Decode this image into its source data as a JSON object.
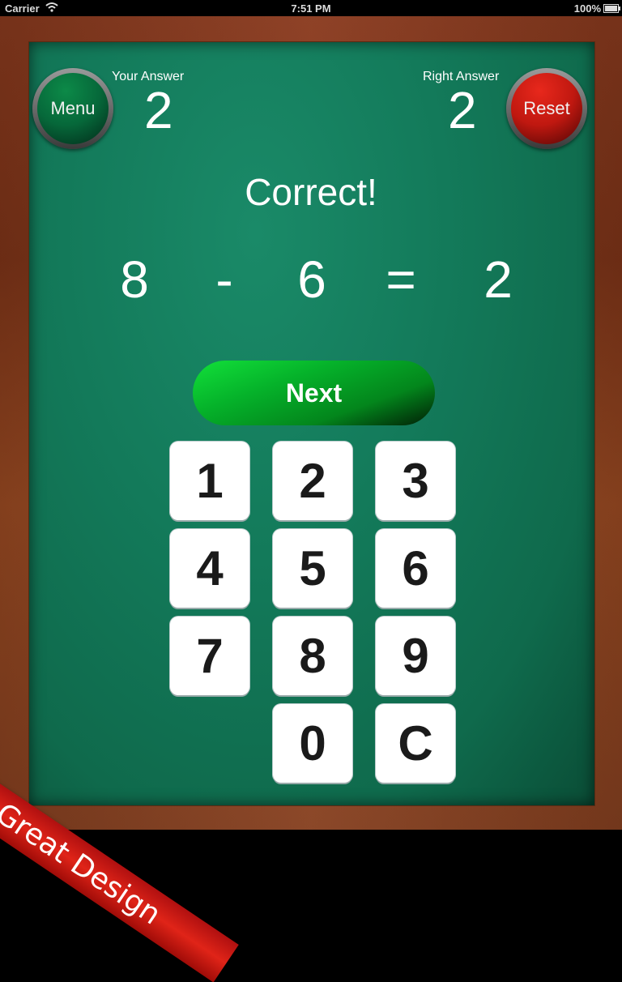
{
  "status_bar": {
    "carrier": "Carrier",
    "time": "7:51 PM",
    "battery": "100%"
  },
  "header": {
    "menu_label": "Menu",
    "reset_label": "Reset",
    "your_answer_label": "Your Answer",
    "your_answer_value": "2",
    "right_answer_label": "Right Answer",
    "right_answer_value": "2"
  },
  "feedback": "Correct!",
  "equation": {
    "operand1": "8",
    "operator": "-",
    "operand2": "6",
    "equals": "=",
    "result": "2"
  },
  "next_label": "Next",
  "keypad": [
    "1",
    "2",
    "3",
    "4",
    "5",
    "6",
    "7",
    "8",
    "9",
    "0",
    "C"
  ],
  "ribbon": "Great Design",
  "colors": {
    "board": "#137a5a",
    "frame": "#8a3a1e",
    "next_green": "#05b22a",
    "reset_red": "#c01810",
    "menu_green": "#06683a"
  }
}
